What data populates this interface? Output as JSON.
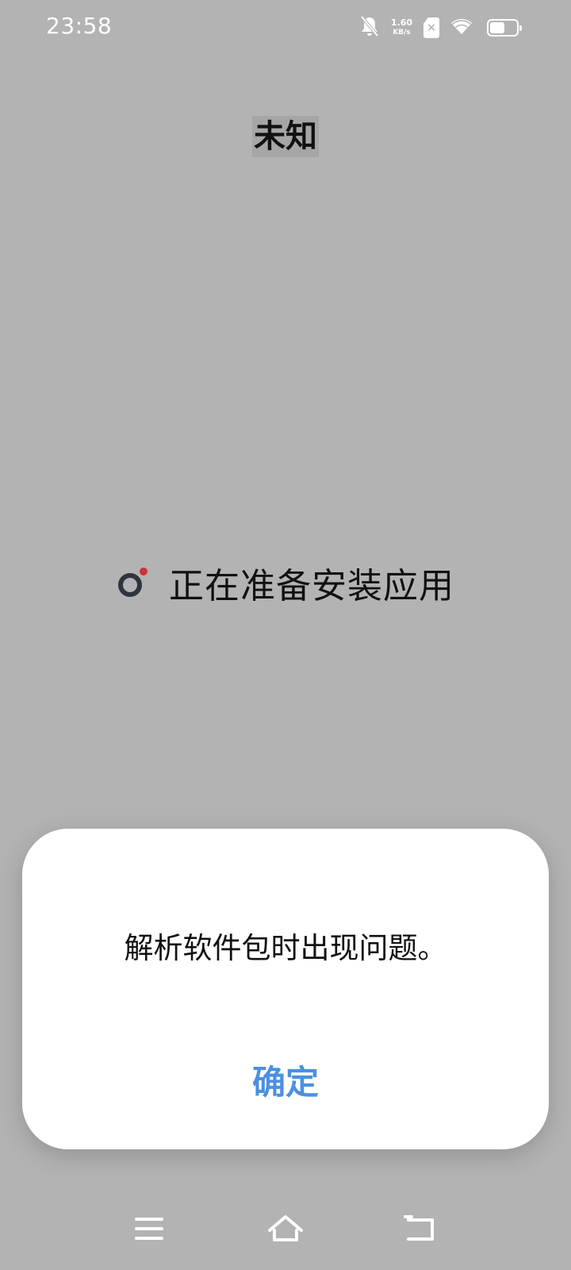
{
  "status_bar": {
    "time": "23:58",
    "net_speed_value": "1.60",
    "net_speed_unit": "KB/s",
    "sim_mark": "×",
    "battery_level": 0.55,
    "icons": [
      "bell-off-icon",
      "sim-icon",
      "wifi-icon",
      "battery-icon"
    ]
  },
  "page": {
    "title": "未知",
    "preparing_text": "正在准备安装应用"
  },
  "dialog": {
    "message": "解析软件包时出现问题。",
    "ok_label": "确定"
  },
  "nav_bar": {
    "icons": [
      "menu-icon",
      "home-icon",
      "back-icon"
    ]
  },
  "colors": {
    "background": "#b3b3b3",
    "accent": "#4a90e2",
    "spinner_dot": "#d0313b",
    "spinner_ring": "#2f3440"
  }
}
